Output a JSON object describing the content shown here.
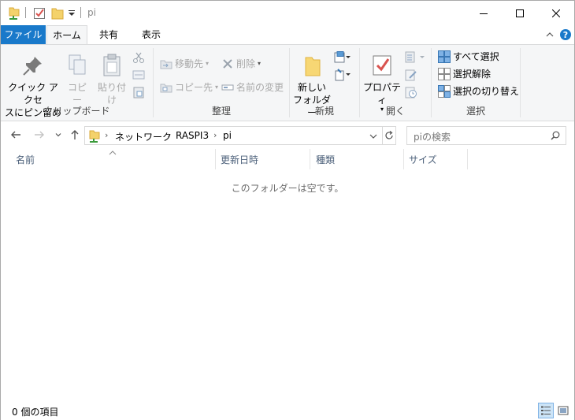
{
  "window": {
    "title": "pi",
    "controls": {
      "minimize": "minimize-icon",
      "maximize": "maximize-icon",
      "close": "close-icon"
    }
  },
  "tabs": [
    {
      "label": "ファイル",
      "active": false
    },
    {
      "label": "ホーム",
      "active": true
    },
    {
      "label": "共有",
      "active": false
    },
    {
      "label": "表示",
      "active": false
    }
  ],
  "ribbon": {
    "clipboard": {
      "label": "クリップボード",
      "pin_line1": "クイック アクセ",
      "pin_line2": "スにピン留め",
      "copy": "コピー",
      "paste": "貼り付け"
    },
    "organize": {
      "label": "整理",
      "move_to": "移動先",
      "copy_to": "コピー先",
      "delete": "削除",
      "rename": "名前の変更"
    },
    "new": {
      "label": "新規",
      "new_folder_line1": "新しい",
      "new_folder_line2": "フォルダー"
    },
    "open": {
      "label": "開く",
      "properties": "プロパティ"
    },
    "select": {
      "label": "選択",
      "select_all": "すべて選択",
      "select_none": "選択解除",
      "invert": "選択の切り替え"
    }
  },
  "address": {
    "crumbs": [
      "ネットワーク",
      "RASPI3",
      "pi"
    ],
    "search_placeholder": "piの検索"
  },
  "columns": [
    "名前",
    "更新日時",
    "種類",
    "サイズ"
  ],
  "content": {
    "empty_message": "このフォルダーは空です。"
  },
  "status": {
    "item_count": "0 個の項目"
  },
  "colors": {
    "accent": "#1979ca",
    "ribbon_bg": "#f5f6f7",
    "header_text": "#4c607a"
  }
}
